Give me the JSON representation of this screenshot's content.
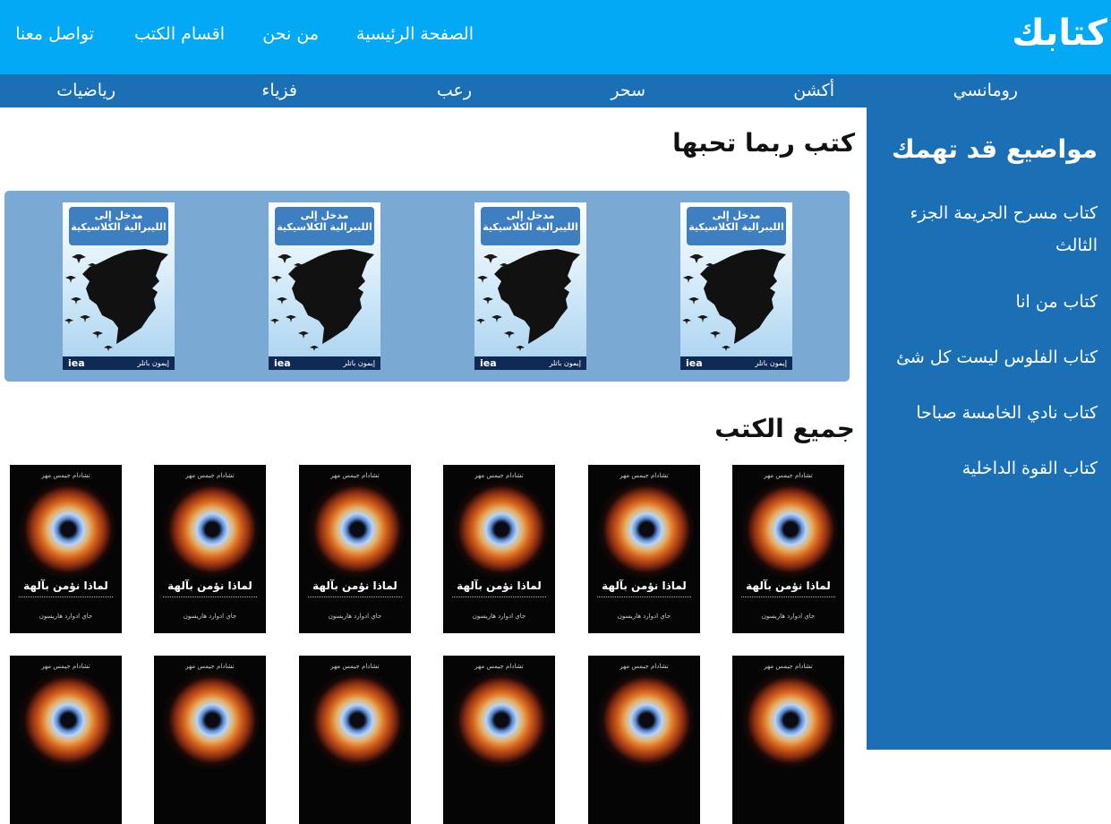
{
  "header": {
    "logo": "كتابك",
    "nav": [
      "الصفحة الرئيسية",
      "من نحن",
      "اقسام الكتب",
      "تواصل معنا"
    ]
  },
  "categories": [
    "رومانسي",
    "أكشن",
    "سحر",
    "رعب",
    "فزياء",
    "رياضيات"
  ],
  "sidebar": {
    "title": "مواضيع قد تهمك",
    "links": [
      "كتاب مسرح الجريمة الجزء الثالث",
      "كتاب من انا",
      "كتاب الفلوس ليست كل شئ",
      "كتاب نادي الخامسة صباحا",
      "كتاب القوة الداخلية"
    ]
  },
  "recommended": {
    "title": "كتب ربما تحبها",
    "book": {
      "label": "مدخل إلى",
      "title": "الليبرالية الكلاسيكية",
      "author": "إيمون باتلر",
      "publisher": "iea"
    }
  },
  "all_books": {
    "title": "جميع الكتب",
    "book": {
      "top": "تشادام جيمس مهر",
      "title": "لماذا نؤمن بآلهة",
      "author": "جاي ادوارد هاريسون"
    }
  },
  "colors": {
    "header": "#03a9f4",
    "category_bar": "#1a6fb5",
    "sidebar": "#1a6fb5",
    "carousel": "#7aa9d4"
  }
}
